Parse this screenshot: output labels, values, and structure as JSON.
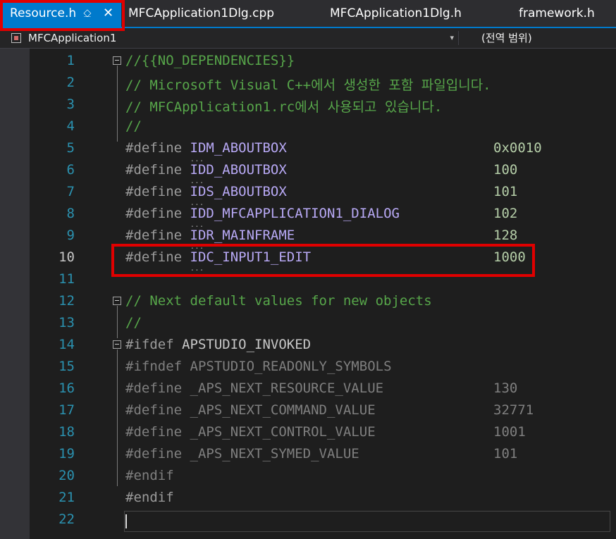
{
  "tabs": [
    {
      "label": "Resource.h",
      "active": true,
      "pinned": true
    },
    {
      "label": "MFCApplication1Dlg.cpp",
      "active": false
    },
    {
      "label": "MFCApplication1Dlg.h",
      "active": false
    },
    {
      "label": "framework.h",
      "active": false
    }
  ],
  "tab_icons": {
    "pin": "⎐",
    "close": "✕"
  },
  "navbar": {
    "project": "MFCApplication1",
    "scope": "(전역 범위)",
    "dropdown_icon": "▾"
  },
  "lines": [
    {
      "num": "1",
      "text": "//{{NO_DEPENDENCIES}}"
    },
    {
      "num": "2",
      "text": "// Microsoft Visual C++에서 생성한 포함 파일입니다."
    },
    {
      "num": "3",
      "text": "// MFCApplication1.rc에서 사용되고 있습니다."
    },
    {
      "num": "4",
      "text": "//"
    },
    {
      "num": "5",
      "kw": "#define",
      "name": "IDM_ABOUTBOX",
      "value": "0x0010"
    },
    {
      "num": "6",
      "kw": "#define",
      "name": "IDD_ABOUTBOX",
      "value": "100"
    },
    {
      "num": "7",
      "kw": "#define",
      "name": "IDS_ABOUTBOX",
      "value": "101"
    },
    {
      "num": "8",
      "kw": "#define",
      "name": "IDD_MFCAPPLICATION1_DIALOG",
      "value": "102"
    },
    {
      "num": "9",
      "kw": "#define",
      "name": "IDR_MAINFRAME",
      "value": "128"
    },
    {
      "num": "10",
      "kw": "#define",
      "name": "IDC_INPUT1_EDIT",
      "value": "1000"
    },
    {
      "num": "11",
      "text": ""
    },
    {
      "num": "12",
      "text": "// Next default values for new objects"
    },
    {
      "num": "13",
      "text": "//"
    },
    {
      "num": "14",
      "kw": "#ifdef",
      "name": "APSTUDIO_INVOKED"
    },
    {
      "num": "15",
      "kw": "#ifndef",
      "name": "APSTUDIO_READONLY_SYMBOLS"
    },
    {
      "num": "16",
      "kw": "#define",
      "name": "_APS_NEXT_RESOURCE_VALUE",
      "value": "130"
    },
    {
      "num": "17",
      "kw": "#define",
      "name": "_APS_NEXT_COMMAND_VALUE",
      "value": "32771"
    },
    {
      "num": "18",
      "kw": "#define",
      "name": "_APS_NEXT_CONTROL_VALUE",
      "value": "1001"
    },
    {
      "num": "19",
      "kw": "#define",
      "name": "_APS_NEXT_SYMED_VALUE",
      "value": "101"
    },
    {
      "num": "20",
      "kw": "#endif"
    },
    {
      "num": "21",
      "kw": "#endif"
    },
    {
      "num": "22",
      "text": ""
    }
  ],
  "colors": {
    "accent": "#007acc",
    "highlight": "#e00000",
    "comment": "#57a64a",
    "line_number": "#2b91af"
  },
  "dots": "..."
}
